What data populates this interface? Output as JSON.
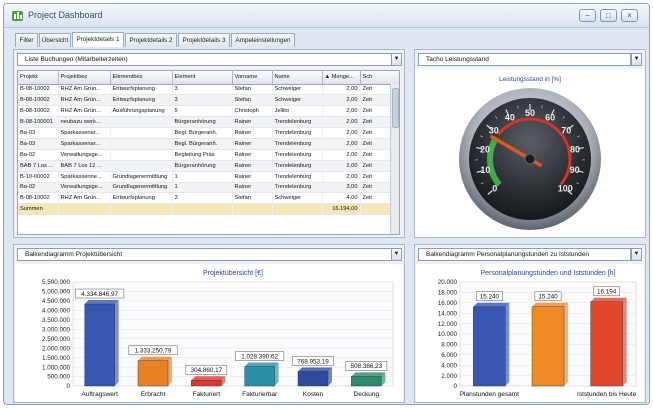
{
  "window": {
    "title": "Project Dashboard",
    "controls": [
      "−",
      "□",
      "×"
    ]
  },
  "tabs": [
    "Filter",
    "Übersicht",
    "Projektdetails 1",
    "Projektdetails 2",
    "Projektdetails 3",
    "Ampeleinstellungen"
  ],
  "active_tab": "Projektdetails 1",
  "bookings_panel": {
    "dropdown": "Liste Buchungen (Mitarbeiterzeiten)",
    "columns": [
      "Projekt",
      "Projektbez",
      "Elementbez",
      "Element",
      "Vorname",
      "Name",
      "▲ Menge...",
      "Sch"
    ],
    "rows": [
      [
        "B-08-10002",
        "RHZ Am Grün...",
        "Entwurfsplanung",
        "3",
        "Stefan",
        "Schweiger",
        "2,00",
        "Zeit"
      ],
      [
        "B-08-10002",
        "RHZ Am Grün...",
        "Entwurfsplanung",
        "3",
        "Stefan",
        "Schweiger",
        "2,00",
        "Zeit"
      ],
      [
        "B-08-10002",
        "RHZ Am Grün...",
        "Ausführungsplanung",
        "5",
        "Christoph",
        "Jellito",
        "2,00",
        "Zeit"
      ],
      [
        "B-08-100001",
        "neubazu werk...",
        "",
        "Bürgeranhörung",
        "Rainer",
        "Trendelenburg",
        "2,00",
        "Zeit"
      ],
      [
        "Ba-03",
        "Sparkassenar...",
        "",
        "Begl. Bürgeranh.",
        "Rainer",
        "Trendelenburg",
        "2,00",
        "Zeit"
      ],
      [
        "Ba-03",
        "Sparkassenar...",
        "",
        "Begl. Bürgeranh.",
        "Rainer",
        "Trendelenburg",
        "2,00",
        "Zeit"
      ],
      [
        "Ba-02",
        "Verwaltungsge...",
        "",
        "Begleitung Präs",
        "Rainer",
        "Trendelenburg",
        "2,00",
        "Zeit"
      ],
      [
        "BAB 7 Los ...",
        "BAB 7 Los 12 ...",
        "",
        "Bürgeranhörung",
        "Rainer",
        "Trendelenburg",
        "2,00",
        "Zeit"
      ],
      [
        "B-10-00002",
        "Sparkassenne...",
        "Grundlagenermittlung",
        "1",
        "Rainer",
        "Trendelenburg",
        "2,00",
        "Zeit"
      ],
      [
        "Ba-02",
        "Verwaltungsge...",
        "Grundlagenermittlung",
        "1",
        "Rainer",
        "Trendelenburg",
        "3,00",
        "Zeit"
      ],
      [
        "B-08-10002",
        "RHZ Am Grün...",
        "Entwurfsplanung",
        "3",
        "Stefan",
        "Schweiger",
        "4,00",
        "Zeit"
      ]
    ],
    "summary_label": "Summen",
    "summary_value": "16.194,00"
  },
  "gauge_panel": {
    "dropdown": "Tacho Leistungsstand",
    "title": "Leistungsstand in [%]",
    "ticks": [
      "0",
      "10",
      "20",
      "30",
      "40",
      "50",
      "60",
      "70",
      "80",
      "90",
      "100"
    ],
    "value_percent": 27,
    "colors": {
      "green": "#3fae49",
      "red": "#d8322a",
      "needle": "#e05a1c"
    }
  },
  "overview_panel": {
    "dropdown": "Balkendiagramm Projektübersicht"
  },
  "hours_panel": {
    "dropdown": "Balkendiagramm Personalplanungstunden zu Iststunden"
  },
  "chart_data": [
    {
      "type": "bar",
      "title": "Projektübersicht [€]",
      "categories": [
        "Auftragswert",
        "Erbracht",
        "Fakturiert",
        "Fakturierbar",
        "Kosten",
        "Deckung"
      ],
      "values": [
        4334846.97,
        1333250.79,
        304860.17,
        1028390.62,
        768953.19,
        508386.23
      ],
      "data_labels": [
        "4.334.846,97",
        "1.333.250,79",
        "304.860,17",
        "1.028.390,62",
        "768.953,19",
        "508.386,23"
      ],
      "colors": [
        "#3656b0",
        "#e88225",
        "#d93a2e",
        "#2b8fa6",
        "#2f4a9c",
        "#2e8a6b"
      ],
      "yticks": [
        "0",
        "500.000",
        "1.000.000",
        "1.500.000",
        "2.000.000",
        "2.500.000",
        "3.000.000",
        "3.500.000",
        "4.000.000",
        "4.500.000",
        "5.000.000",
        "5.500.000"
      ],
      "ylim": [
        0,
        5500000
      ],
      "grid": true
    },
    {
      "type": "bar",
      "title": "Personalplanungstunden und Iststunden [h]",
      "categories": [
        "Planstunden gesamt",
        "",
        "Iststunden bis Heute"
      ],
      "values": [
        15240,
        15240,
        16194
      ],
      "data_labels": [
        "15.240",
        "15.240",
        "16.194"
      ],
      "colors": [
        "#3656b0",
        "#f08a24",
        "#e0482a"
      ],
      "yticks": [
        "0",
        "2.000",
        "4.000",
        "6.000",
        "8.000",
        "10.000",
        "12.000",
        "14.000",
        "16.000",
        "18.000",
        "20.000"
      ],
      "ylim": [
        0,
        20000
      ],
      "grid": true
    }
  ]
}
